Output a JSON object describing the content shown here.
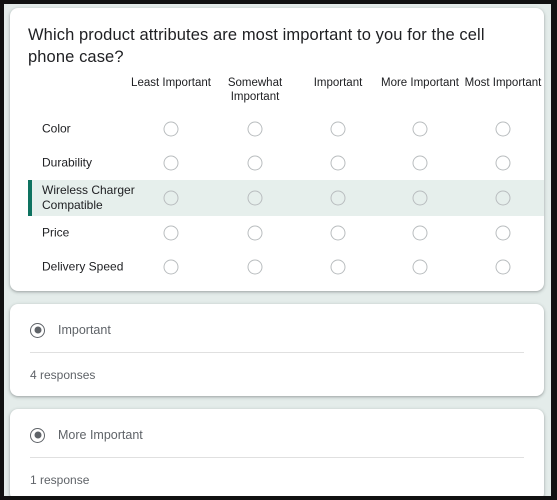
{
  "question": {
    "title": "Which product attributes are most important to you for the cell phone case?",
    "columns": [
      {
        "label": "Least Important"
      },
      {
        "label": "Somewhat Important"
      },
      {
        "label": "Important"
      },
      {
        "label": "More Important"
      },
      {
        "label": "Most Important"
      }
    ],
    "rows": [
      {
        "label": "Color",
        "highlighted": false
      },
      {
        "label": "Durability",
        "highlighted": false
      },
      {
        "label": "Wireless Charger Compatible",
        "highlighted": true
      },
      {
        "label": "Price",
        "highlighted": false
      },
      {
        "label": "Delivery Speed",
        "highlighted": false
      }
    ]
  },
  "responses": [
    {
      "option": "Important",
      "count_label": "4 responses"
    },
    {
      "option": "More Important",
      "count_label": "1 response"
    }
  ],
  "colors": {
    "page_background": "#e4ecea",
    "card_background": "#ffffff",
    "highlight_row": "#e6efec",
    "highlight_accent": "#0e7260",
    "text_primary": "#202124",
    "text_secondary": "#5f6368",
    "radio_border": "#b9bdbf"
  }
}
